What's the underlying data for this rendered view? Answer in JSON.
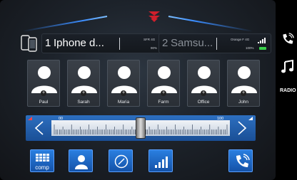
{
  "phones": [
    {
      "num": "1",
      "name": "Iphone d...",
      "carrier": "SFR 4G",
      "battery": "90%",
      "battery_color": "#ffffff",
      "active": true
    },
    {
      "num": "2",
      "name": "Samsu...",
      "carrier": "Orange F 4G",
      "battery": "100%",
      "battery_color": "#39d24a",
      "active": false
    }
  ],
  "contacts": [
    "Paul",
    "Sarah",
    "Maria",
    "Farm",
    "Office",
    "John"
  ],
  "tuner": {
    "min_label": "00",
    "max_label": "100",
    "position": 0.5
  },
  "bottom_buttons": {
    "comp_label": "comp",
    "icons": [
      "keypad-icon",
      "person-icon",
      "compass-icon",
      "signal-icon",
      "phone-settings-icon"
    ]
  },
  "side": {
    "radio_label": "RADIO"
  },
  "colors": {
    "accent": "#2a7fe0",
    "brand": "#d01f2c",
    "battery_full": "#39d24a"
  }
}
